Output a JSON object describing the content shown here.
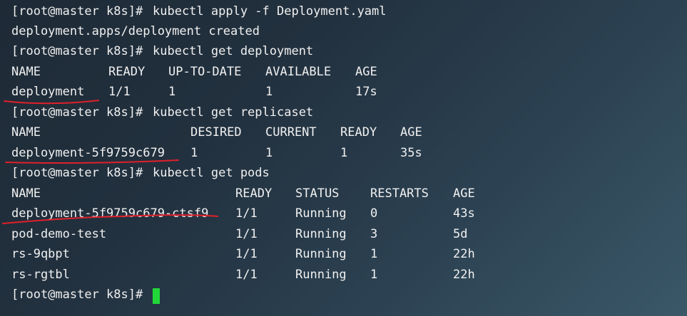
{
  "terminal": {
    "prompt": "[root@master k8s]#",
    "commands": [
      "kubectl apply -f Deployment.yaml",
      "kubectl get deployment",
      "kubectl get replicaset",
      "kubectl get pods"
    ],
    "apply_output": "deployment.apps/deployment created",
    "deployment_table": {
      "headers": [
        "NAME",
        "READY",
        "UP-TO-DATE",
        "AVAILABLE",
        "AGE"
      ],
      "rows": [
        [
          "deployment",
          "1/1",
          "1",
          "1",
          "17s"
        ]
      ]
    },
    "replicaset_table": {
      "headers": [
        "NAME",
        "DESIRED",
        "CURRENT",
        "READY",
        "AGE"
      ],
      "rows": [
        [
          "deployment-5f9759c679",
          "1",
          "1",
          "1",
          "35s"
        ]
      ]
    },
    "pods_table": {
      "headers": [
        "NAME",
        "READY",
        "STATUS",
        "RESTARTS",
        "AGE"
      ],
      "rows": [
        [
          "deployment-5f9759c679-ctsf9",
          "1/1",
          "Running",
          "0",
          "43s"
        ],
        [
          "pod-demo-test",
          "1/1",
          "Running",
          "3",
          "5d"
        ],
        [
          "rs-9qbpt",
          "1/1",
          "Running",
          "1",
          "22h"
        ],
        [
          "rs-rgtbl",
          "1/1",
          "Running",
          "1",
          "22h"
        ]
      ]
    },
    "colors": {
      "text": "#f0f0f0",
      "cursor": "#22d63a",
      "annotation": "#e0202a"
    }
  }
}
